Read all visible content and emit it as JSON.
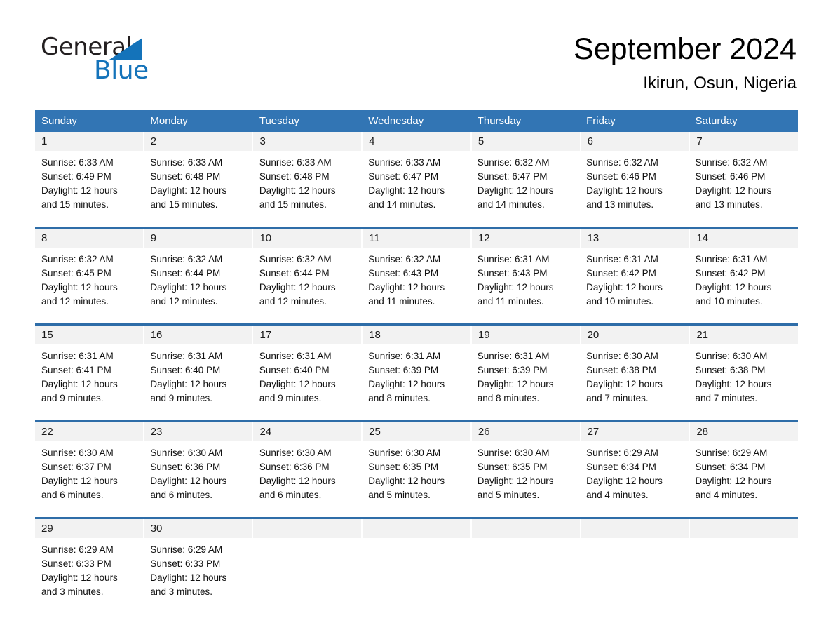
{
  "brand": {
    "name_part1": "General",
    "name_part2": "Blue",
    "triangle_color": "#1473BA"
  },
  "header": {
    "month_title": "September 2024",
    "location": "Ikirun, Osun, Nigeria"
  },
  "theme": {
    "header_blue": "#3275B4",
    "rule_blue": "#2E6DA8",
    "date_strip_gray": "#f2f2f2"
  },
  "weekdays": [
    "Sunday",
    "Monday",
    "Tuesday",
    "Wednesday",
    "Thursday",
    "Friday",
    "Saturday"
  ],
  "weeks": [
    {
      "days": [
        {
          "date": "1",
          "sunrise": "Sunrise: 6:33 AM",
          "sunset": "Sunset: 6:49 PM",
          "daylight1": "Daylight: 12 hours",
          "daylight2": "and 15 minutes."
        },
        {
          "date": "2",
          "sunrise": "Sunrise: 6:33 AM",
          "sunset": "Sunset: 6:48 PM",
          "daylight1": "Daylight: 12 hours",
          "daylight2": "and 15 minutes."
        },
        {
          "date": "3",
          "sunrise": "Sunrise: 6:33 AM",
          "sunset": "Sunset: 6:48 PM",
          "daylight1": "Daylight: 12 hours",
          "daylight2": "and 15 minutes."
        },
        {
          "date": "4",
          "sunrise": "Sunrise: 6:33 AM",
          "sunset": "Sunset: 6:47 PM",
          "daylight1": "Daylight: 12 hours",
          "daylight2": "and 14 minutes."
        },
        {
          "date": "5",
          "sunrise": "Sunrise: 6:32 AM",
          "sunset": "Sunset: 6:47 PM",
          "daylight1": "Daylight: 12 hours",
          "daylight2": "and 14 minutes."
        },
        {
          "date": "6",
          "sunrise": "Sunrise: 6:32 AM",
          "sunset": "Sunset: 6:46 PM",
          "daylight1": "Daylight: 12 hours",
          "daylight2": "and 13 minutes."
        },
        {
          "date": "7",
          "sunrise": "Sunrise: 6:32 AM",
          "sunset": "Sunset: 6:46 PM",
          "daylight1": "Daylight: 12 hours",
          "daylight2": "and 13 minutes."
        }
      ]
    },
    {
      "days": [
        {
          "date": "8",
          "sunrise": "Sunrise: 6:32 AM",
          "sunset": "Sunset: 6:45 PM",
          "daylight1": "Daylight: 12 hours",
          "daylight2": "and 12 minutes."
        },
        {
          "date": "9",
          "sunrise": "Sunrise: 6:32 AM",
          "sunset": "Sunset: 6:44 PM",
          "daylight1": "Daylight: 12 hours",
          "daylight2": "and 12 minutes."
        },
        {
          "date": "10",
          "sunrise": "Sunrise: 6:32 AM",
          "sunset": "Sunset: 6:44 PM",
          "daylight1": "Daylight: 12 hours",
          "daylight2": "and 12 minutes."
        },
        {
          "date": "11",
          "sunrise": "Sunrise: 6:32 AM",
          "sunset": "Sunset: 6:43 PM",
          "daylight1": "Daylight: 12 hours",
          "daylight2": "and 11 minutes."
        },
        {
          "date": "12",
          "sunrise": "Sunrise: 6:31 AM",
          "sunset": "Sunset: 6:43 PM",
          "daylight1": "Daylight: 12 hours",
          "daylight2": "and 11 minutes."
        },
        {
          "date": "13",
          "sunrise": "Sunrise: 6:31 AM",
          "sunset": "Sunset: 6:42 PM",
          "daylight1": "Daylight: 12 hours",
          "daylight2": "and 10 minutes."
        },
        {
          "date": "14",
          "sunrise": "Sunrise: 6:31 AM",
          "sunset": "Sunset: 6:42 PM",
          "daylight1": "Daylight: 12 hours",
          "daylight2": "and 10 minutes."
        }
      ]
    },
    {
      "days": [
        {
          "date": "15",
          "sunrise": "Sunrise: 6:31 AM",
          "sunset": "Sunset: 6:41 PM",
          "daylight1": "Daylight: 12 hours",
          "daylight2": "and 9 minutes."
        },
        {
          "date": "16",
          "sunrise": "Sunrise: 6:31 AM",
          "sunset": "Sunset: 6:40 PM",
          "daylight1": "Daylight: 12 hours",
          "daylight2": "and 9 minutes."
        },
        {
          "date": "17",
          "sunrise": "Sunrise: 6:31 AM",
          "sunset": "Sunset: 6:40 PM",
          "daylight1": "Daylight: 12 hours",
          "daylight2": "and 9 minutes."
        },
        {
          "date": "18",
          "sunrise": "Sunrise: 6:31 AM",
          "sunset": "Sunset: 6:39 PM",
          "daylight1": "Daylight: 12 hours",
          "daylight2": "and 8 minutes."
        },
        {
          "date": "19",
          "sunrise": "Sunrise: 6:31 AM",
          "sunset": "Sunset: 6:39 PM",
          "daylight1": "Daylight: 12 hours",
          "daylight2": "and 8 minutes."
        },
        {
          "date": "20",
          "sunrise": "Sunrise: 6:30 AM",
          "sunset": "Sunset: 6:38 PM",
          "daylight1": "Daylight: 12 hours",
          "daylight2": "and 7 minutes."
        },
        {
          "date": "21",
          "sunrise": "Sunrise: 6:30 AM",
          "sunset": "Sunset: 6:38 PM",
          "daylight1": "Daylight: 12 hours",
          "daylight2": "and 7 minutes."
        }
      ]
    },
    {
      "days": [
        {
          "date": "22",
          "sunrise": "Sunrise: 6:30 AM",
          "sunset": "Sunset: 6:37 PM",
          "daylight1": "Daylight: 12 hours",
          "daylight2": "and 6 minutes."
        },
        {
          "date": "23",
          "sunrise": "Sunrise: 6:30 AM",
          "sunset": "Sunset: 6:36 PM",
          "daylight1": "Daylight: 12 hours",
          "daylight2": "and 6 minutes."
        },
        {
          "date": "24",
          "sunrise": "Sunrise: 6:30 AM",
          "sunset": "Sunset: 6:36 PM",
          "daylight1": "Daylight: 12 hours",
          "daylight2": "and 6 minutes."
        },
        {
          "date": "25",
          "sunrise": "Sunrise: 6:30 AM",
          "sunset": "Sunset: 6:35 PM",
          "daylight1": "Daylight: 12 hours",
          "daylight2": "and 5 minutes."
        },
        {
          "date": "26",
          "sunrise": "Sunrise: 6:30 AM",
          "sunset": "Sunset: 6:35 PM",
          "daylight1": "Daylight: 12 hours",
          "daylight2": "and 5 minutes."
        },
        {
          "date": "27",
          "sunrise": "Sunrise: 6:29 AM",
          "sunset": "Sunset: 6:34 PM",
          "daylight1": "Daylight: 12 hours",
          "daylight2": "and 4 minutes."
        },
        {
          "date": "28",
          "sunrise": "Sunrise: 6:29 AM",
          "sunset": "Sunset: 6:34 PM",
          "daylight1": "Daylight: 12 hours",
          "daylight2": "and 4 minutes."
        }
      ]
    },
    {
      "days": [
        {
          "date": "29",
          "sunrise": "Sunrise: 6:29 AM",
          "sunset": "Sunset: 6:33 PM",
          "daylight1": "Daylight: 12 hours",
          "daylight2": "and 3 minutes."
        },
        {
          "date": "30",
          "sunrise": "Sunrise: 6:29 AM",
          "sunset": "Sunset: 6:33 PM",
          "daylight1": "Daylight: 12 hours",
          "daylight2": "and 3 minutes."
        },
        {
          "date": "",
          "sunrise": "",
          "sunset": "",
          "daylight1": "",
          "daylight2": ""
        },
        {
          "date": "",
          "sunrise": "",
          "sunset": "",
          "daylight1": "",
          "daylight2": ""
        },
        {
          "date": "",
          "sunrise": "",
          "sunset": "",
          "daylight1": "",
          "daylight2": ""
        },
        {
          "date": "",
          "sunrise": "",
          "sunset": "",
          "daylight1": "",
          "daylight2": ""
        },
        {
          "date": "",
          "sunrise": "",
          "sunset": "",
          "daylight1": "",
          "daylight2": ""
        }
      ]
    }
  ]
}
